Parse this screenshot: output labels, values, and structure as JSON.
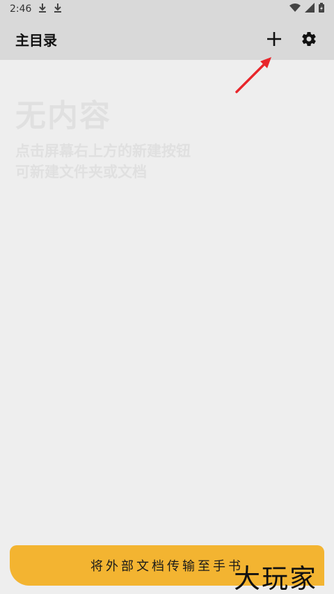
{
  "status_bar": {
    "time": "2:46",
    "icons": [
      "download-icon",
      "download-icon",
      "wifi-icon",
      "signal-icon",
      "battery-icon"
    ]
  },
  "app_bar": {
    "title": "主目录",
    "actions": [
      "add-icon",
      "gear-icon"
    ]
  },
  "empty_state": {
    "title": "无内容",
    "line1": "点击屏幕右上方的新建按钮",
    "line2": "可新建文件夹或文档"
  },
  "bottom_button": {
    "label": "将外部文档传输至手书"
  },
  "watermark": {
    "text": "大玩家"
  },
  "colors": {
    "bar_bg": "#d9d9d9",
    "page_bg": "#eeeeee",
    "accent": "#f3b431",
    "arrow": "#e8262b"
  }
}
